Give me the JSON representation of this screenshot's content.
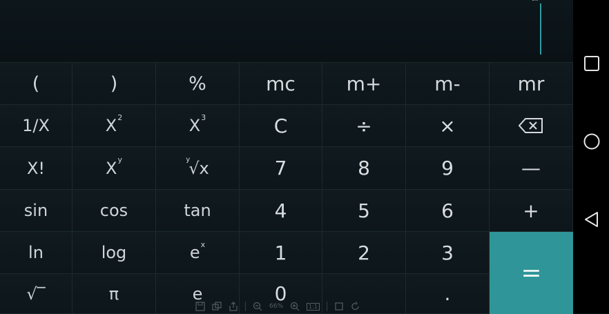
{
  "display": {
    "expression": ""
  },
  "keys": {
    "row1": [
      "(",
      ")",
      "%",
      "mc",
      "m+",
      "m-",
      "mr"
    ],
    "row2": {
      "reciprocal": "1/X",
      "square_base": "X",
      "square_exp": "2",
      "cube_base": "X",
      "cube_exp": "3",
      "clear": "C",
      "divide": "÷",
      "multiply": "×"
    },
    "row3": {
      "factorial": "X!",
      "power_base": "X",
      "power_exp": "y",
      "root_index": "y",
      "root_body": "√x",
      "seven": "7",
      "eight": "8",
      "nine": "9",
      "minus": "—"
    },
    "row4": [
      "sin",
      "cos",
      "tan",
      "4",
      "5",
      "6",
      "+"
    ],
    "row5": {
      "ln": "ln",
      "log": "log",
      "exp_base": "e",
      "exp_exp": "x",
      "one": "1",
      "two": "2",
      "three": "3"
    },
    "row6": {
      "sqrt": "√‾",
      "pi": "π",
      "e": "e",
      "zero": "0",
      "dot": "."
    },
    "equals": "="
  },
  "toolbar": {
    "zoom": "66%",
    "actual_size": "1:1"
  },
  "icons": [
    "backspace-icon",
    "square-icon",
    "circle-icon",
    "back-triangle-icon",
    "save-icon",
    "copy-icon",
    "share-icon",
    "zoom-out-icon",
    "zoom-in-icon",
    "fit-icon",
    "rotate-icon"
  ],
  "colors": {
    "accent": "#2f9598",
    "background": "#0c1418",
    "cursor": "#2e9ba4"
  }
}
